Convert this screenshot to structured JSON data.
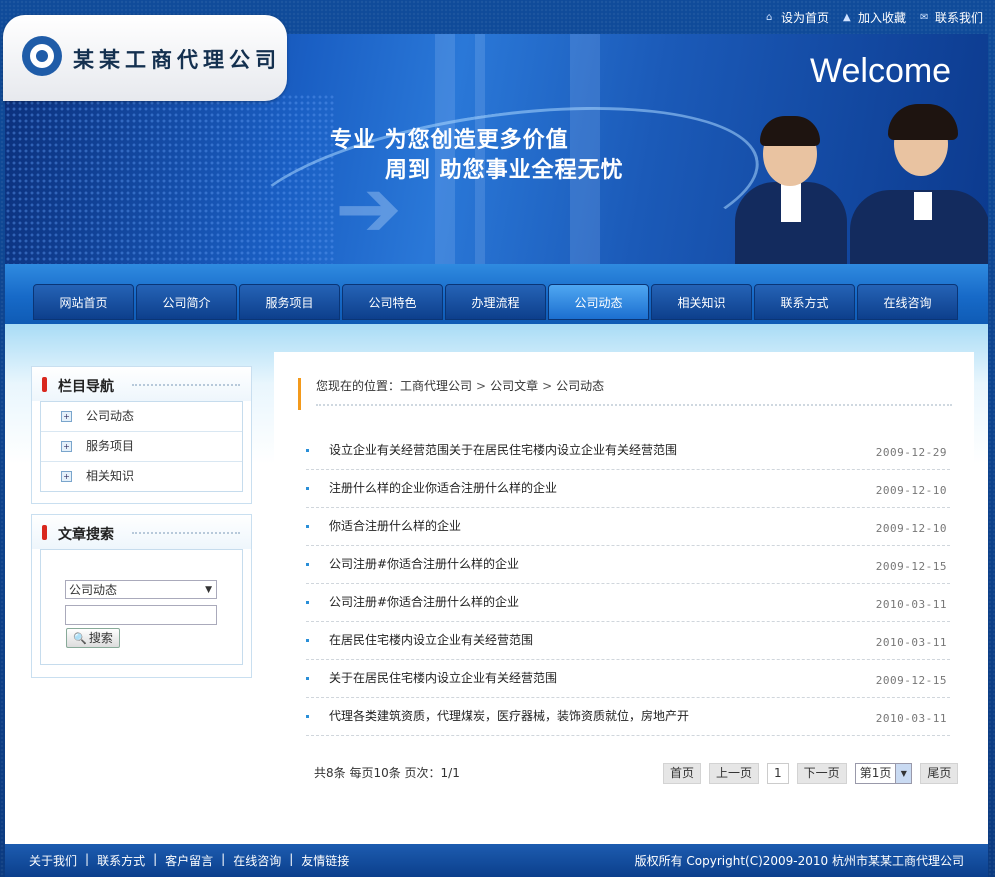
{
  "top_links": [
    {
      "icon": "home-icon",
      "label": "设为首页"
    },
    {
      "icon": "bookmark-icon",
      "label": "加入收藏"
    },
    {
      "icon": "contact-icon",
      "label": "联系我们"
    }
  ],
  "logo": {
    "name": "某某工商代理公司"
  },
  "banner": {
    "welcome": "Welcome",
    "slogan1": "专业 为您创造更多价值",
    "slogan2": "周到 助您事业全程无忧"
  },
  "nav": [
    "网站首页",
    "公司简介",
    "服务项目",
    "公司特色",
    "办理流程",
    "公司动态",
    "相关知识",
    "联系方式",
    "在线咨询"
  ],
  "nav_active": "公司动态",
  "sidebar": {
    "cat_title": "栏目导航",
    "categories": [
      "公司动态",
      "服务项目",
      "相关知识"
    ],
    "search_title": "文章搜索",
    "search_select": "公司动态",
    "search_button": "搜索"
  },
  "breadcrumb": {
    "prefix": "您现在的位置：",
    "items": [
      "工商代理公司",
      "公司文章",
      "公司动态"
    ],
    "sep": ">"
  },
  "articles": [
    {
      "title": "设立企业有关经营范围关于在居民住宅楼内设立企业有关经营范围",
      "date": "2009-12-29"
    },
    {
      "title": "注册什么样的企业你适合注册什么样的企业",
      "date": "2009-12-10"
    },
    {
      "title": "你适合注册什么样的企业",
      "date": "2009-12-10"
    },
    {
      "title": "公司注册#你适合注册什么样的企业",
      "date": "2009-12-15"
    },
    {
      "title": "公司注册#你适合注册什么样的企业",
      "date": "2010-03-11"
    },
    {
      "title": "在居民住宅楼内设立企业有关经营范围",
      "date": "2010-03-11"
    },
    {
      "title": "关于在居民住宅楼内设立企业有关经营范围",
      "date": "2009-12-15"
    },
    {
      "title": "代理各类建筑资质，代理煤炭，医疗器械，装饰资质就位，房地产开",
      "date": "2010-03-11"
    }
  ],
  "pager": {
    "info": "共8条  每页10条  页次：1/1",
    "first": "首页",
    "prev": "上一页",
    "current": "1",
    "next": "下一页",
    "select": "第1页",
    "last": "尾页"
  },
  "footer": {
    "links": [
      "关于我们",
      "联系方式",
      "客户留言",
      "在线咨询",
      "友情链接"
    ],
    "sep": "|",
    "copyright": "版权所有  Copyright(C)2009-2010 杭州市某某工商代理公司"
  },
  "colors": {
    "brand": "#1a5fc4",
    "accent": "#f39a1c",
    "marker": "#d9281e"
  }
}
